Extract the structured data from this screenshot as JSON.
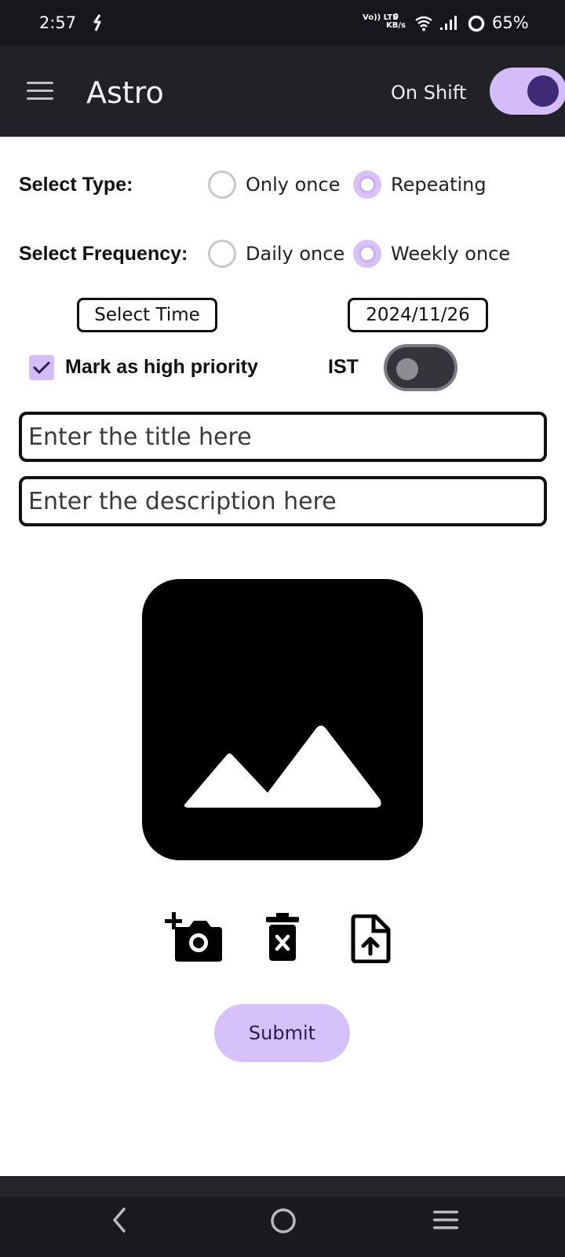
{
  "status_bar": {
    "time": "2:57",
    "network": "Vo)) LTE",
    "speed_value": "0",
    "speed_unit": "KB/s",
    "battery": "65%"
  },
  "app_bar": {
    "title": "Astro",
    "shift_label": "On Shift",
    "shift_on": true
  },
  "type_row": {
    "label": "Select Type:",
    "options": [
      "Only once",
      "Repeating"
    ],
    "selected": "Repeating"
  },
  "frequency_row": {
    "label": "Select Frequency:",
    "options": [
      "Daily once",
      "Weekly once"
    ],
    "selected": "Weekly once"
  },
  "time_button": "Select Time",
  "date_button": "2024/11/26",
  "priority": {
    "label": "Mark as high priority",
    "checked": true
  },
  "timezone": {
    "label": "IST",
    "on": false
  },
  "title_input": {
    "placeholder": "Enter the title here",
    "value": ""
  },
  "description_input": {
    "placeholder": "Enter the description here",
    "value": ""
  },
  "image_actions": [
    "add-photo-icon",
    "delete-icon",
    "upload-file-icon"
  ],
  "submit_label": "Submit",
  "colors": {
    "accent": "#d3bcf8",
    "accent_dark": "#3f2a78",
    "appbar": "#212128",
    "statusbar": "#16161c"
  }
}
